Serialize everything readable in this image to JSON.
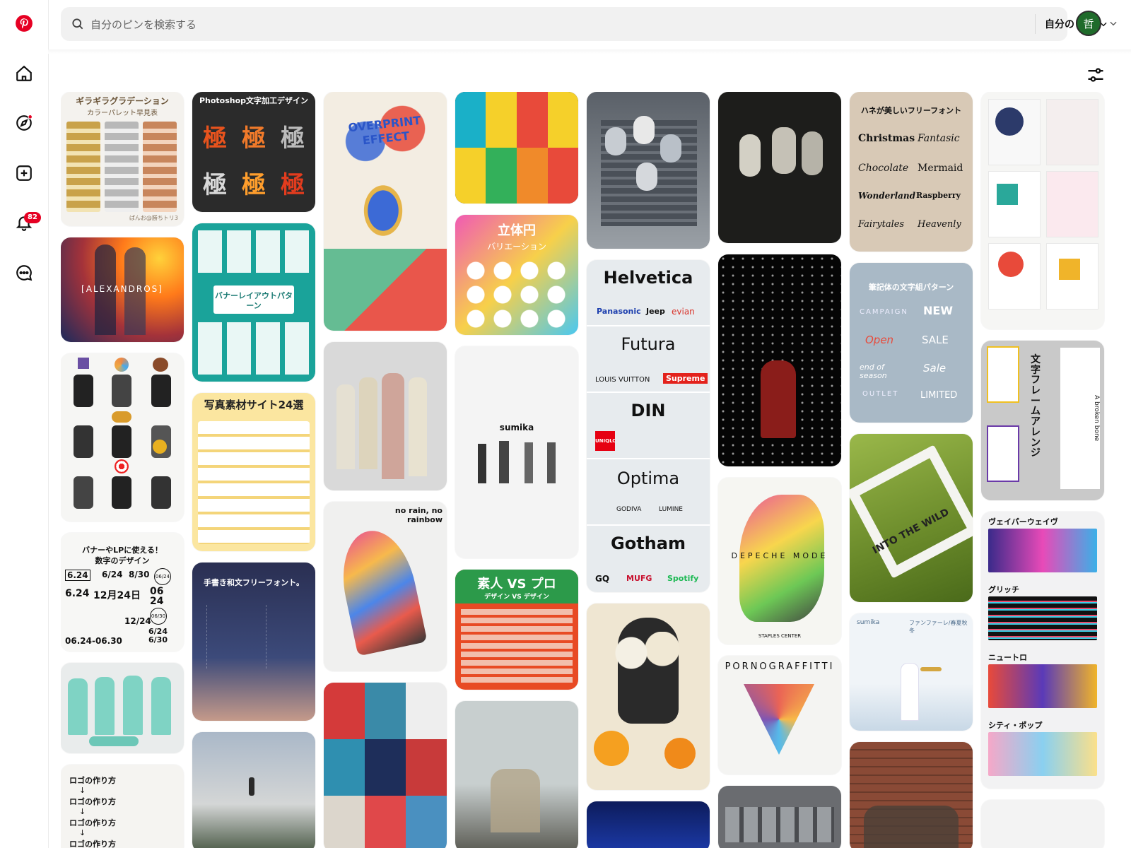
{
  "search": {
    "placeholder": "自分のピンを検索する"
  },
  "scope_dropdown": {
    "label": "自分のピン"
  },
  "avatar": {
    "initial": "哲"
  },
  "notifications": {
    "count": "82"
  },
  "nav_icons": [
    "pinterest-logo-icon",
    "home-icon",
    "explore-icon",
    "create-icon",
    "notifications-icon",
    "messages-icon"
  ],
  "pins": {
    "c1p1": {
      "title": "ギラギラグラデーション",
      "sub": "カラーパレット早見表",
      "foot": "ぱんお@勝ちトリ3"
    },
    "c1p2": {
      "title": "[ALEXANDROS]"
    },
    "c1p4": {
      "title": "バナーやLPに使える！",
      "sub": "数字のデザイン",
      "dates": [
        "6.24",
        "6/24",
        "8/30",
        "06/24",
        "6.24",
        "12月24日",
        "06 24",
        "06/30",
        "06.24-06.30",
        "12/24",
        "6/24 6/30"
      ]
    },
    "c1p6": {
      "lines": [
        "ロゴの作り方",
        "ロゴの作り方",
        "ロゴの作り方",
        "ロゴの作り方"
      ]
    },
    "c2p1": {
      "title": "Photoshop文字加工デザイン",
      "glyph": "極"
    },
    "c2p2": {
      "title": "バナーレイアウトパターン"
    },
    "c2p3": {
      "title": "写真素材サイト24選"
    },
    "c2p4": {
      "title": "手書き和文フリーフォント。"
    },
    "c3p1": {
      "title": "OVERPRINT EFFECT"
    },
    "c3p3": {
      "title": "no rain, no rainbow"
    },
    "c4p2": {
      "title": "立体円",
      "sub": "バリエーション"
    },
    "c4p3": {
      "title": "sumika"
    },
    "c4p4": {
      "title": "素人 VS プロ",
      "sub": "デザイン VS デザイン"
    },
    "c5p2": {
      "fonts": [
        "Helvetica",
        "Futura",
        "DIN",
        "Optima",
        "Gotham"
      ],
      "brands": [
        "Panasonic",
        "Jeep",
        "evian",
        "LOUIS VUITTON",
        "Supreme",
        "UNIQLO",
        "GODIVA",
        "LUMINE",
        "GQ",
        "MUFG",
        "Spotify"
      ]
    },
    "c6p3": {
      "title": "DEPECHE MODE",
      "foot": "STAPLES CENTER"
    },
    "c6p4": {
      "title": "PORNOGRAFFITTI"
    },
    "c7p1": {
      "title": "ハネが美しいフリーフォント",
      "words": [
        "Christmas",
        "Fantasic",
        "Chocolate",
        "Mermaid",
        "Wonderland",
        "Raspberry",
        "Fairytales",
        "Heavenly"
      ]
    },
    "c7p2": {
      "title": "筆記体の文字組パターン",
      "words": [
        "CAMPAIGN",
        "NEW",
        "Open",
        "SALE",
        "end of season",
        "Sale",
        "OUTLET",
        "LIMITED"
      ]
    },
    "c7p3": {
      "title": "INTO THE WILD"
    },
    "c7p4": {
      "title": "sumika",
      "sub": "ファンファーレ/春夏秋冬"
    },
    "c8p2": {
      "title": "文字フレームアレンジ",
      "sub": "A broken bone"
    },
    "c8p3": {
      "sections": [
        "ヴェイパーウェイヴ",
        "グリッチ",
        "ニュートロ",
        "シティ・ポップ"
      ]
    }
  },
  "colors": {
    "brand": "#E60023",
    "search_bg": "#F1F1F1",
    "avatar_bg": "#1F6B2B"
  }
}
